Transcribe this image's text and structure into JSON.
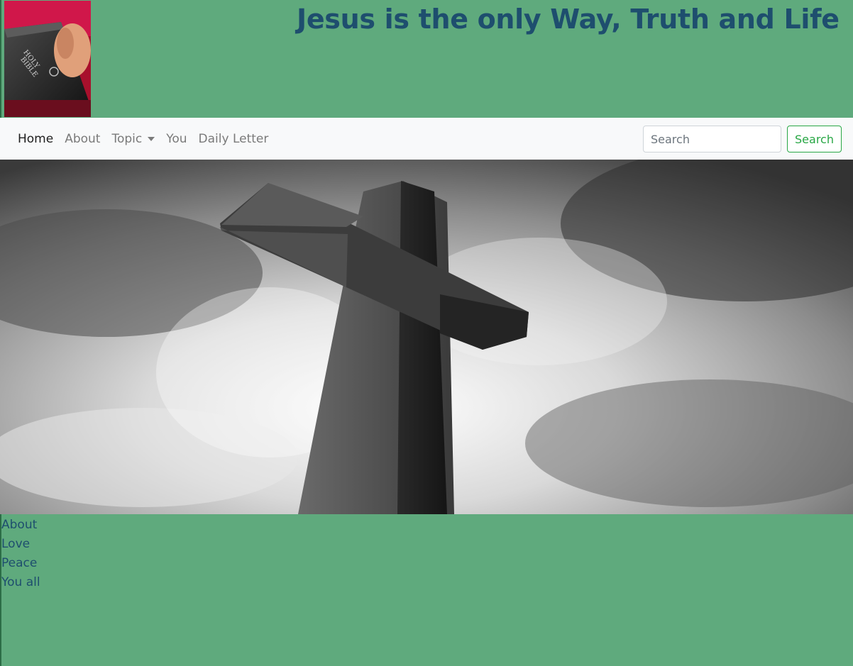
{
  "header": {
    "title": "Jesus is the only Way, Truth and Life",
    "logo": {
      "label": "HOLY BIBLE",
      "icon": "bible-logo"
    },
    "background_color": "#5faa7d",
    "title_color": "#1e4e6e"
  },
  "navbar": {
    "links": [
      {
        "label": "Home",
        "active": true
      },
      {
        "label": "About"
      },
      {
        "label": "Topic",
        "dropdown": true
      },
      {
        "label": "You"
      },
      {
        "label": "Daily Letter"
      }
    ],
    "search": {
      "placeholder": "Search",
      "button_label": "Search"
    },
    "background_color": "#f8f9fa",
    "accent_color": "#28a745"
  },
  "hero": {
    "image": "cross-image"
  },
  "content": {
    "links": [
      "About",
      "Love",
      "Peace",
      "You all"
    ],
    "background_color": "#5faa7d",
    "text_color": "#1e4e6e"
  }
}
